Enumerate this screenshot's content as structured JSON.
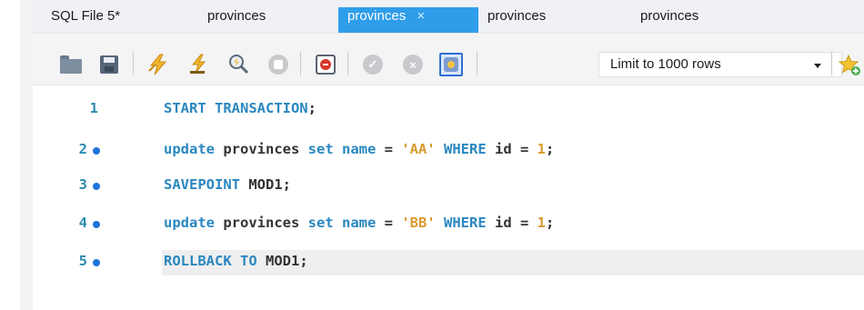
{
  "tabs": [
    {
      "label": "SQL File 5*",
      "active": false
    },
    {
      "label": "provinces",
      "active": false
    },
    {
      "label": "provinces",
      "active": true,
      "close": "×"
    },
    {
      "label": "provinces",
      "active": false
    },
    {
      "label": "provinces",
      "active": false
    }
  ],
  "toolbar": {
    "icons": [
      "open-folder-icon",
      "save-icon",
      "execute-icon",
      "execute-current-icon",
      "explain-icon",
      "stop-icon",
      "toggle-error-icon",
      "commit-icon",
      "rollback-icon",
      "autocommit-toggle-icon",
      "add-snippet-icon"
    ],
    "limit_select": "Limit to 1000 rows"
  },
  "editor": {
    "lines": [
      {
        "number": "1",
        "marker": false,
        "tokens": [
          {
            "t": "START TRANSACTION",
            "c": "kw"
          },
          {
            "t": ";",
            "c": "pun"
          }
        ]
      },
      {
        "number": "2",
        "marker": true,
        "tokens": [
          {
            "t": "update",
            "c": "kw"
          },
          {
            "t": " provinces ",
            "c": "id"
          },
          {
            "t": "set",
            "c": "kw"
          },
          {
            "t": " ",
            "c": "id"
          },
          {
            "t": "name",
            "c": "kw"
          },
          {
            "t": " = ",
            "c": "pun"
          },
          {
            "t": "'AA'",
            "c": "str"
          },
          {
            "t": " ",
            "c": "id"
          },
          {
            "t": "WHERE",
            "c": "kw"
          },
          {
            "t": " id = ",
            "c": "id"
          },
          {
            "t": "1",
            "c": "num"
          },
          {
            "t": ";",
            "c": "pun"
          }
        ]
      },
      {
        "number": "3",
        "marker": true,
        "tokens": [
          {
            "t": "SAVEPOINT",
            "c": "kw"
          },
          {
            "t": " MOD1",
            "c": "id"
          },
          {
            "t": ";",
            "c": "pun"
          }
        ]
      },
      {
        "number": "4",
        "marker": true,
        "tokens": [
          {
            "t": "update",
            "c": "kw"
          },
          {
            "t": " provinces ",
            "c": "id"
          },
          {
            "t": "set",
            "c": "kw"
          },
          {
            "t": " ",
            "c": "id"
          },
          {
            "t": "name",
            "c": "kw"
          },
          {
            "t": " = ",
            "c": "pun"
          },
          {
            "t": "'BB'",
            "c": "str"
          },
          {
            "t": " ",
            "c": "id"
          },
          {
            "t": "WHERE",
            "c": "kw"
          },
          {
            "t": " id = ",
            "c": "id"
          },
          {
            "t": "1",
            "c": "num"
          },
          {
            "t": ";",
            "c": "pun"
          }
        ]
      },
      {
        "number": "5",
        "marker": true,
        "current": true,
        "tokens": [
          {
            "t": "ROLLBACK TO",
            "c": "kw"
          },
          {
            "t": " MOD1",
            "c": "id"
          },
          {
            "t": ";",
            "c": "pun"
          }
        ]
      }
    ]
  }
}
